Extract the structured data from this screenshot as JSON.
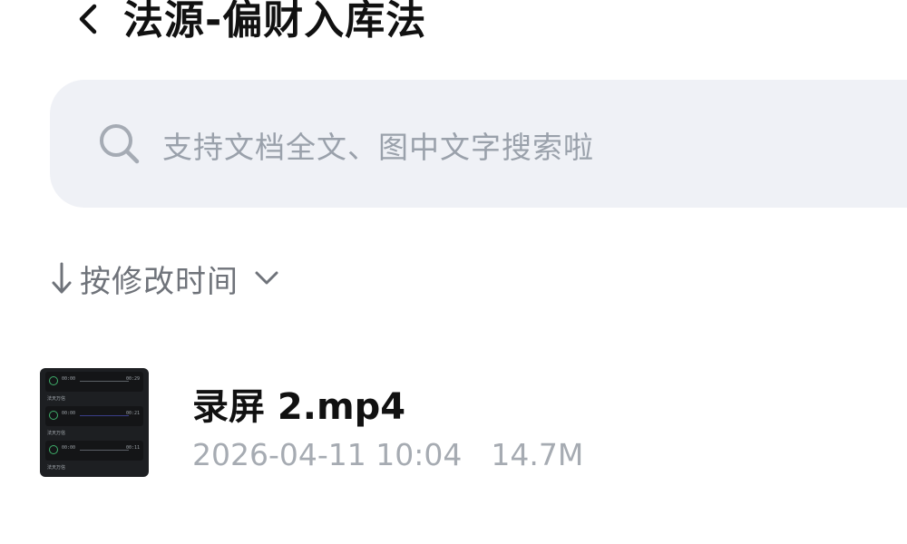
{
  "header": {
    "title": "法源-偏财入库法",
    "back_icon": "chevron-left-icon"
  },
  "search": {
    "placeholder": "支持文档全文、图中文字搜索啦",
    "icon": "search-icon"
  },
  "sort": {
    "label": "按修改时间",
    "direction_icon": "arrow-down-icon",
    "dropdown_icon": "chevron-down-icon"
  },
  "files": [
    {
      "name": "录屏 2.mp4",
      "modified": "2026-04-11 10:04",
      "size": "14.7M",
      "thumbnail": {
        "rows": [
          {
            "start": "00:00",
            "end": "00:29",
            "caption": "法天万信"
          },
          {
            "start": "00:00",
            "end": "00:21",
            "caption": "法天万信"
          },
          {
            "start": "00:00",
            "end": "00:11",
            "caption": "法天万信"
          }
        ]
      }
    }
  ],
  "colors": {
    "search_bg": "#eff1f6",
    "placeholder": "#9aa1ab",
    "meta_text": "#a6abb2",
    "sort_text": "#6f737a",
    "thumb_bg": "#1d1f22",
    "thumb_accent": "#3fae6a"
  }
}
